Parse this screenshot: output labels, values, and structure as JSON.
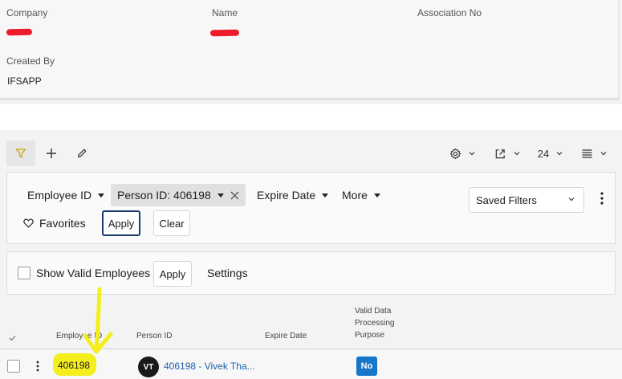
{
  "header": {
    "company_label": "Company",
    "name_label": "Name",
    "association_label": "Association No",
    "created_by_label": "Created By",
    "created_by_value": "IFSAPP"
  },
  "toolbar": {
    "page_size": "24"
  },
  "filters": {
    "employee_id_label": "Employee ID",
    "person_id_chip": "Person ID: 406198",
    "expire_date_label": "Expire Date",
    "more_label": "More",
    "favorites_label": "Favorites",
    "apply_label": "Apply",
    "clear_label": "Clear",
    "saved_filters_label": "Saved Filters"
  },
  "valid_panel": {
    "show_valid_label": "Show Valid Employees",
    "apply_label": "Apply",
    "settings_label": "Settings"
  },
  "table": {
    "headers": {
      "employee_id": "Employee ID",
      "person_id": "Person ID",
      "expire_date": "Expire Date",
      "valid_purpose_1": "Valid Data",
      "valid_purpose_2": "Processing",
      "valid_purpose_3": "Purpose"
    },
    "rows": [
      {
        "employee_id": "406198",
        "avatar_initials": "VT",
        "person_link": "406198 - Vivek Tha...",
        "valid_purpose": "No"
      }
    ]
  },
  "colors": {
    "redaction": "#ee1b2b",
    "highlight": "#f4ee1c",
    "annotation_arrow": "#f4ee1c",
    "link": "#1f5fa8",
    "no_badge": "#1677c9",
    "primary_border": "#1b3a6b",
    "filter_icon": "#c9a800"
  }
}
